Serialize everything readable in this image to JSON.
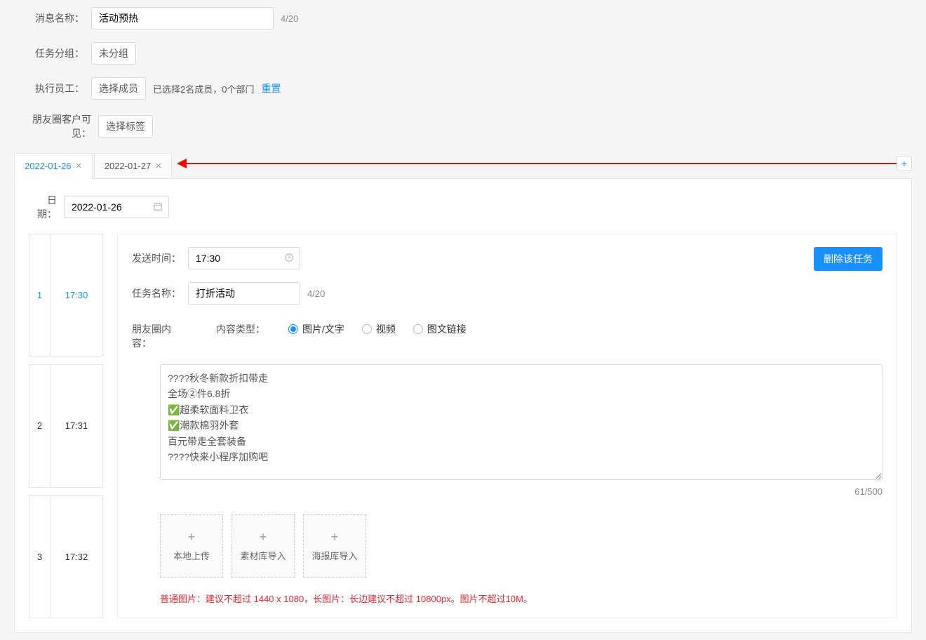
{
  "form": {
    "message_name_label": "消息名称：",
    "message_name_value": "活动预热",
    "message_name_counter": "4/20",
    "task_group_label": "任务分组：",
    "task_group_value": "未分组",
    "exec_staff_label": "执行员工：",
    "exec_staff_button": "选择成员",
    "exec_staff_info": "已选择2名成员，0个部门",
    "exec_staff_reset": "重置",
    "visibility_label": "朋友圈客户可见：",
    "visibility_button": "选择标签"
  },
  "tabs": {
    "items": [
      {
        "label": "2022-01-26",
        "active": true
      },
      {
        "label": "2022-01-27",
        "active": false
      }
    ],
    "add_icon": "+"
  },
  "date_field": {
    "label": "日期：",
    "value": "2022-01-26"
  },
  "time_slots": [
    {
      "index": "1",
      "time": "17:30",
      "active": true
    },
    {
      "index": "2",
      "time": "17:31",
      "active": false
    },
    {
      "index": "3",
      "time": "17:32",
      "active": false
    }
  ],
  "task": {
    "delete_button": "删除该任务",
    "send_time_label": "发送时间：",
    "send_time_value": "17:30",
    "task_name_label": "任务名称：",
    "task_name_value": "打折活动",
    "task_name_counter": "4/20",
    "content_label": "朋友圈内容：",
    "content_type_label": "内容类型：",
    "content_types": {
      "image_text": "图片/文字",
      "video": "视频",
      "link": "图文链接"
    },
    "textarea_value": "????秋冬新款折扣带走\n全场②件6.8折\n✅超柔软面料卫衣\n✅潮款棉羽外套\n百元带走全套装备\n????快来小程序加购吧",
    "textarea_counter": "61/500",
    "uploads": {
      "local": "本地上传",
      "material": "素材库导入",
      "poster": "海报库导入"
    },
    "image_hint": "普通图片：建议不超过 1440 x 1080，长图片：长边建议不超过 10800px。图片不超过10M。"
  }
}
